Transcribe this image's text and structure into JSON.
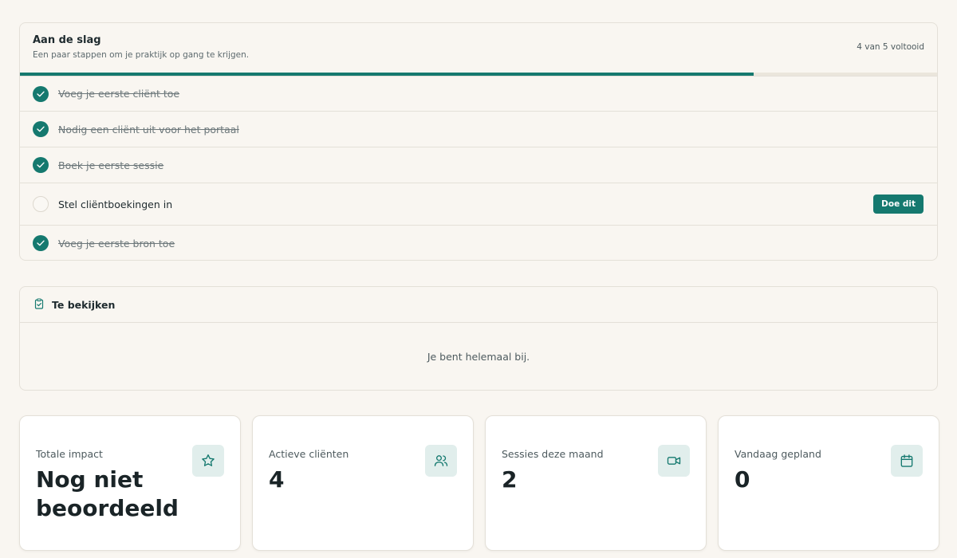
{
  "onboarding": {
    "title": "Aan de slag",
    "subtitle": "Een paar stappen om je praktijk op gang te krijgen.",
    "progress_text": "4 van 5 voltooid",
    "progress_fraction": 0.8,
    "do_button_label": "Doe dit",
    "tasks": [
      {
        "label": "Voeg je eerste cliënt toe",
        "done": true
      },
      {
        "label": "Nodig een cliënt uit voor het portaal",
        "done": true
      },
      {
        "label": "Boek je eerste sessie",
        "done": true
      },
      {
        "label": "Stel cliëntboekingen in",
        "done": false
      },
      {
        "label": "Voeg je eerste bron toe",
        "done": true
      }
    ]
  },
  "review": {
    "title": "Te bekijken",
    "icon": "clipboard-check-icon",
    "empty_text": "Je bent helemaal bij."
  },
  "stats": [
    {
      "label": "Totale impact",
      "value": "Nog niet beoordeeld",
      "icon": "star-icon"
    },
    {
      "label": "Actieve cliënten",
      "value": "4",
      "icon": "users-icon"
    },
    {
      "label": "Sessies deze maand",
      "value": "2",
      "icon": "video-icon"
    },
    {
      "label": "Vandaag gepland",
      "value": "0",
      "icon": "calendar-icon"
    }
  ],
  "colors": {
    "accent": "#15796f",
    "background": "#f9f6f1",
    "icon_bg": "#e1eeec"
  }
}
